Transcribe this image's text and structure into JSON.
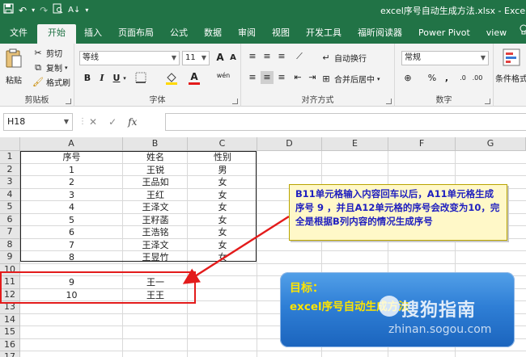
{
  "window": {
    "title": "excel序号自动生成方法.xlsx - Excel"
  },
  "qat": [
    "save-icon",
    "undo-icon",
    "redo-icon",
    "print-preview-icon",
    "sort-icon",
    "more-icon"
  ],
  "tabs": [
    {
      "label": "文件",
      "active": false
    },
    {
      "label": "开始",
      "active": true
    },
    {
      "label": "插入",
      "active": false
    },
    {
      "label": "页面布局",
      "active": false
    },
    {
      "label": "公式",
      "active": false
    },
    {
      "label": "数据",
      "active": false
    },
    {
      "label": "审阅",
      "active": false
    },
    {
      "label": "视图",
      "active": false
    },
    {
      "label": "开发工具",
      "active": false
    },
    {
      "label": "福昕阅读器",
      "active": false
    },
    {
      "label": "Power Pivot",
      "active": false
    },
    {
      "label": "view",
      "active": false
    }
  ],
  "ribbon": {
    "clipboard": {
      "paste": "粘贴",
      "cut": "剪切",
      "copy": "复制",
      "format_painter": "格式刷",
      "label": "剪贴板"
    },
    "font": {
      "name": "等线",
      "size": "11",
      "label": "字体",
      "bold": "B",
      "italic": "I",
      "underline": "U",
      "grow": "A",
      "shrink": "A",
      "wen": "wén"
    },
    "alignment": {
      "wrap": "自动换行",
      "merge": "合并后居中",
      "label": "对齐方式"
    },
    "number": {
      "format": "常规",
      "percent": "%",
      "comma": ",",
      "label": "数字"
    },
    "styles": {
      "conditional": "条件格式"
    }
  },
  "formula_bar": {
    "name_box": "H18",
    "fx": "fx",
    "value": ""
  },
  "sheet": {
    "columns": [
      "A",
      "B",
      "C",
      "D",
      "E",
      "F",
      "G"
    ],
    "rows": [
      "1",
      "2",
      "3",
      "4",
      "5",
      "6",
      "7",
      "8",
      "9",
      "10",
      "11",
      "12",
      "13",
      "14",
      "15",
      "16",
      "17"
    ],
    "cells": [
      [
        "序号",
        "姓名",
        "性别"
      ],
      [
        "1",
        "王锐",
        "男"
      ],
      [
        "2",
        "王品如",
        "女"
      ],
      [
        "3",
        "王红",
        "女"
      ],
      [
        "4",
        "王泽文",
        "女"
      ],
      [
        "5",
        "王籽菡",
        "女"
      ],
      [
        "6",
        "王浩铭",
        "女"
      ],
      [
        "7",
        "王泽文",
        "女"
      ],
      [
        "8",
        "王昱竹",
        "女"
      ],
      [
        "",
        "",
        ""
      ],
      [
        "9",
        "王一",
        ""
      ],
      [
        "10",
        "王王",
        ""
      ]
    ]
  },
  "callout": {
    "text": "B11单元格输入内容回车以后，A11单元格生成序号 9 ，并且A12单元格的序号会改变为10，完全是根据B列内容的情况生成序号"
  },
  "target": {
    "title": "目标：",
    "subtitle": "excel序号自动生成方法"
  },
  "watermark": {
    "logo": "搜狗指南",
    "url": "zhinan.sogou.com"
  },
  "colors": {
    "excel_green": "#217346",
    "callout_text": "#1f1fbf",
    "callout_bg": "#fff8c8",
    "red_annotation": "#e31b1b",
    "target_text": "#ffe400",
    "target_bg": "#2f7fd6"
  }
}
